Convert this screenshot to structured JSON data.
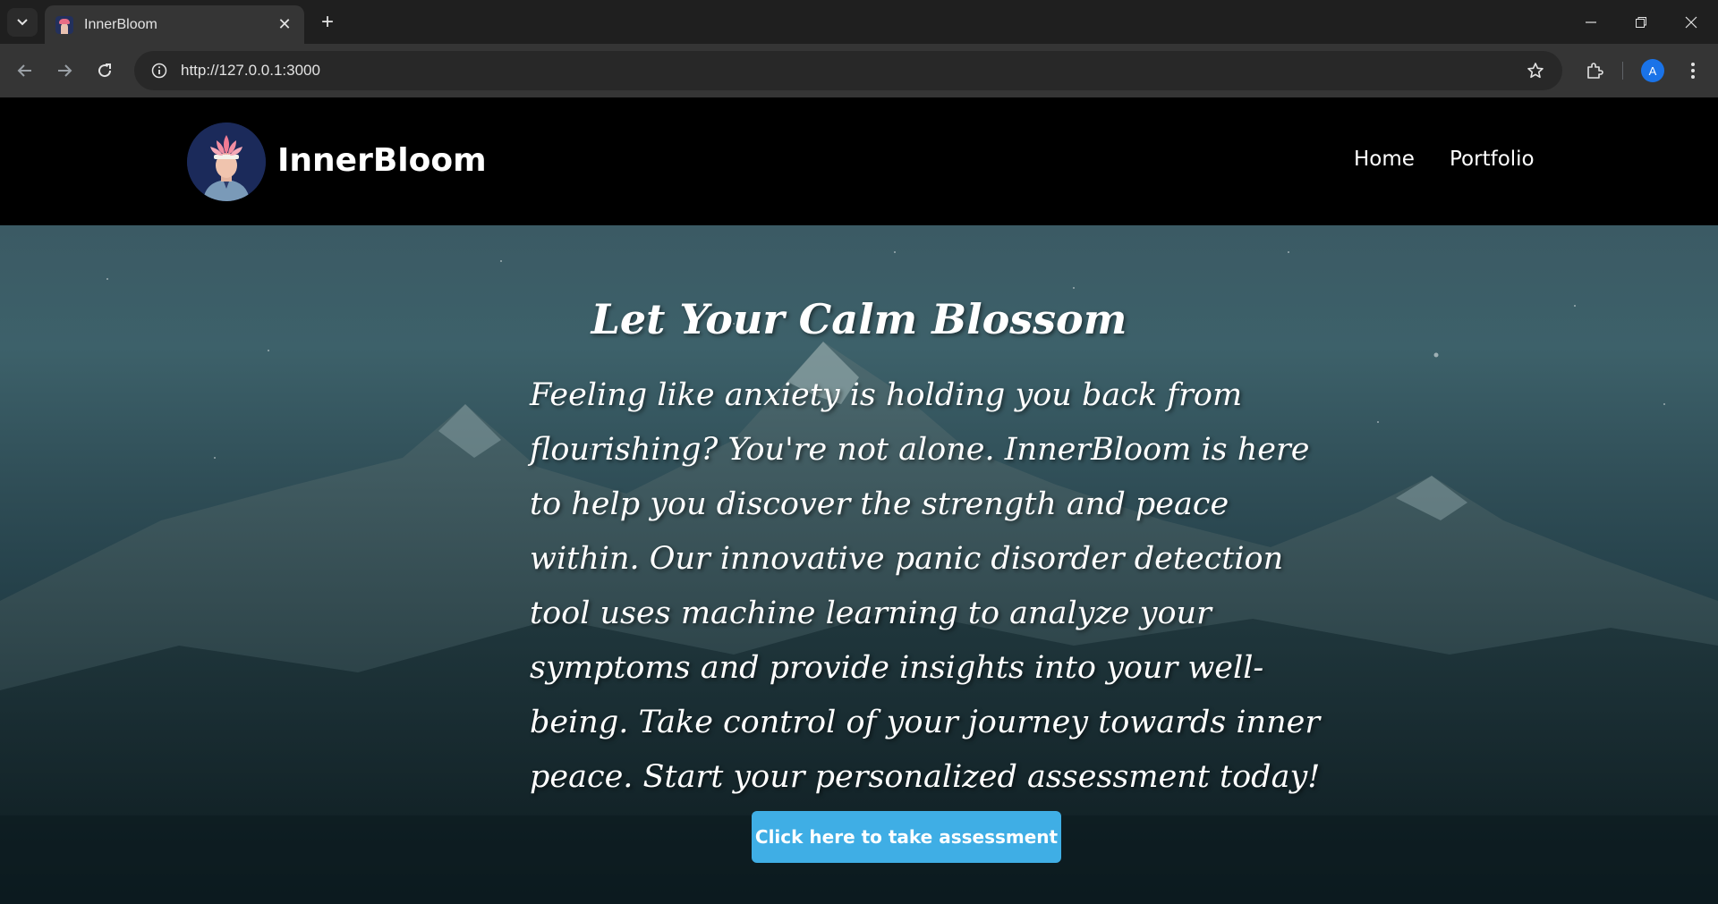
{
  "browser": {
    "tab_title": "InnerBloom",
    "url": "http://127.0.0.1:3000",
    "profile_initial": "A"
  },
  "site": {
    "brand": "InnerBloom",
    "nav": [
      {
        "label": "Home"
      },
      {
        "label": "Portfolio"
      }
    ]
  },
  "hero": {
    "title": "Let Your Calm Blossom",
    "body": "Feeling like anxiety is holding you back from flourishing? You're not alone. InnerBloom is here to help you discover the strength and peace within. Our innovative panic disorder detection tool uses machine learning to analyze your symptoms and provide insights into your well-being. Take control of your journey towards inner peace. Start your personalized assessment today!",
    "cta_label": "Click here to take assessment"
  },
  "colors": {
    "accent": "#3faee5",
    "header_bg": "#000000"
  }
}
